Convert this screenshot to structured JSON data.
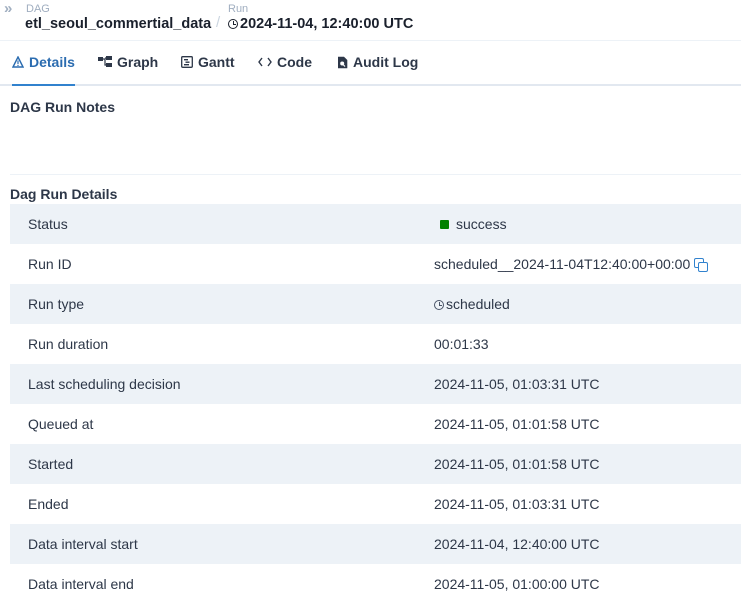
{
  "breadcrumb": {
    "dag_label": "DAG",
    "dag_id": "etl_seoul_commertial_data",
    "separator": "/",
    "run_label": "Run",
    "run_value": "2024-11-04, 12:40:00 UTC"
  },
  "tabs": [
    {
      "label": "Details",
      "icon": "warning-triangle-icon",
      "active": true
    },
    {
      "label": "Graph",
      "icon": "graph-icon"
    },
    {
      "label": "Gantt",
      "icon": "gantt-icon"
    },
    {
      "label": "Code",
      "icon": "code-icon"
    },
    {
      "label": "Audit Log",
      "icon": "document-search-icon"
    }
  ],
  "notes": {
    "title": "DAG Run Notes"
  },
  "details": {
    "title": "Dag Run Details",
    "rows": [
      {
        "key": "Status",
        "value": "success"
      },
      {
        "key": "Run ID",
        "value": "scheduled__2024-11-04T12:40:00+00:00"
      },
      {
        "key": "Run type",
        "value": "scheduled"
      },
      {
        "key": "Run duration",
        "value": "00:01:33"
      },
      {
        "key": "Last scheduling decision",
        "value": "2024-11-05, 01:03:31 UTC"
      },
      {
        "key": "Queued at",
        "value": "2024-11-05, 01:01:58 UTC"
      },
      {
        "key": "Started",
        "value": "2024-11-05, 01:01:58 UTC"
      },
      {
        "key": "Ended",
        "value": "2024-11-05, 01:03:31 UTC"
      },
      {
        "key": "Data interval start",
        "value": "2024-11-04, 12:40:00 UTC"
      },
      {
        "key": "Data interval end",
        "value": "2024-11-05, 01:00:00 UTC"
      }
    ]
  },
  "colors": {
    "accent": "#3182ce",
    "success": "#008000",
    "row_alt": "#edf2f7"
  }
}
